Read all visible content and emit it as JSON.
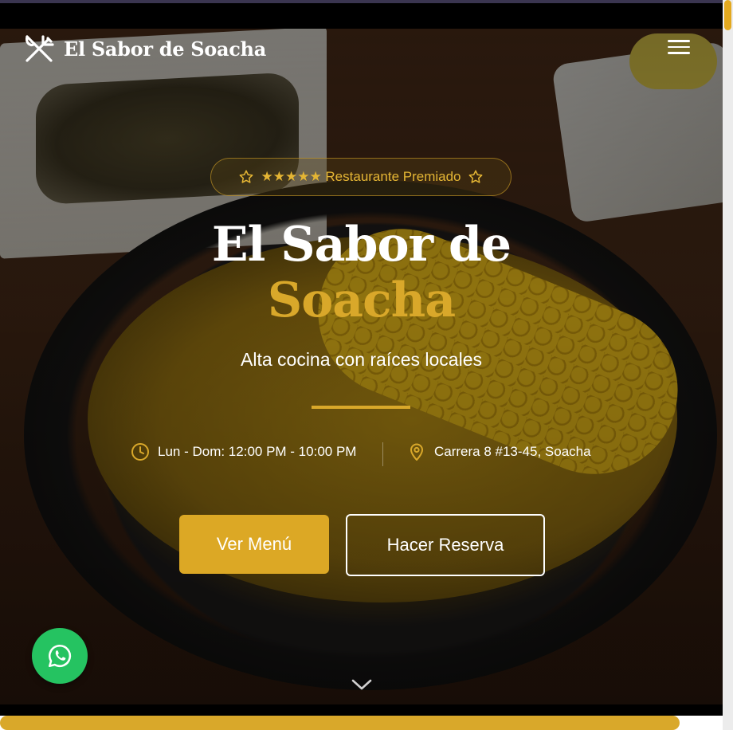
{
  "colors": {
    "accent": "#d9a82a",
    "button_primary": "#dca825",
    "whatsapp": "#25c361"
  },
  "navbar": {
    "brand_name": "El Sabor de Soacha",
    "brand_icon": "utensils-icon",
    "menu_icon": "hamburger-menu-icon"
  },
  "hero": {
    "badge_text": "★★★★★ Restaurante Premiado",
    "badge_icon": "star-outline-icon",
    "title_line1": "El Sabor de",
    "title_line2": "Soacha",
    "subtitle": "Alta cocina con raíces locales",
    "hours": "Lun - Dom: 12:00 PM - 10:00 PM",
    "hours_icon": "clock-icon",
    "address": "Carrera 8 #13-45, Soacha",
    "address_icon": "map-pin-icon",
    "primary_button": "Ver Menú",
    "secondary_button": "Hacer Reserva",
    "scroll_icon": "chevron-down-icon"
  },
  "floating": {
    "whatsapp_icon": "whatsapp-icon"
  },
  "scroll_progress": 0.94
}
